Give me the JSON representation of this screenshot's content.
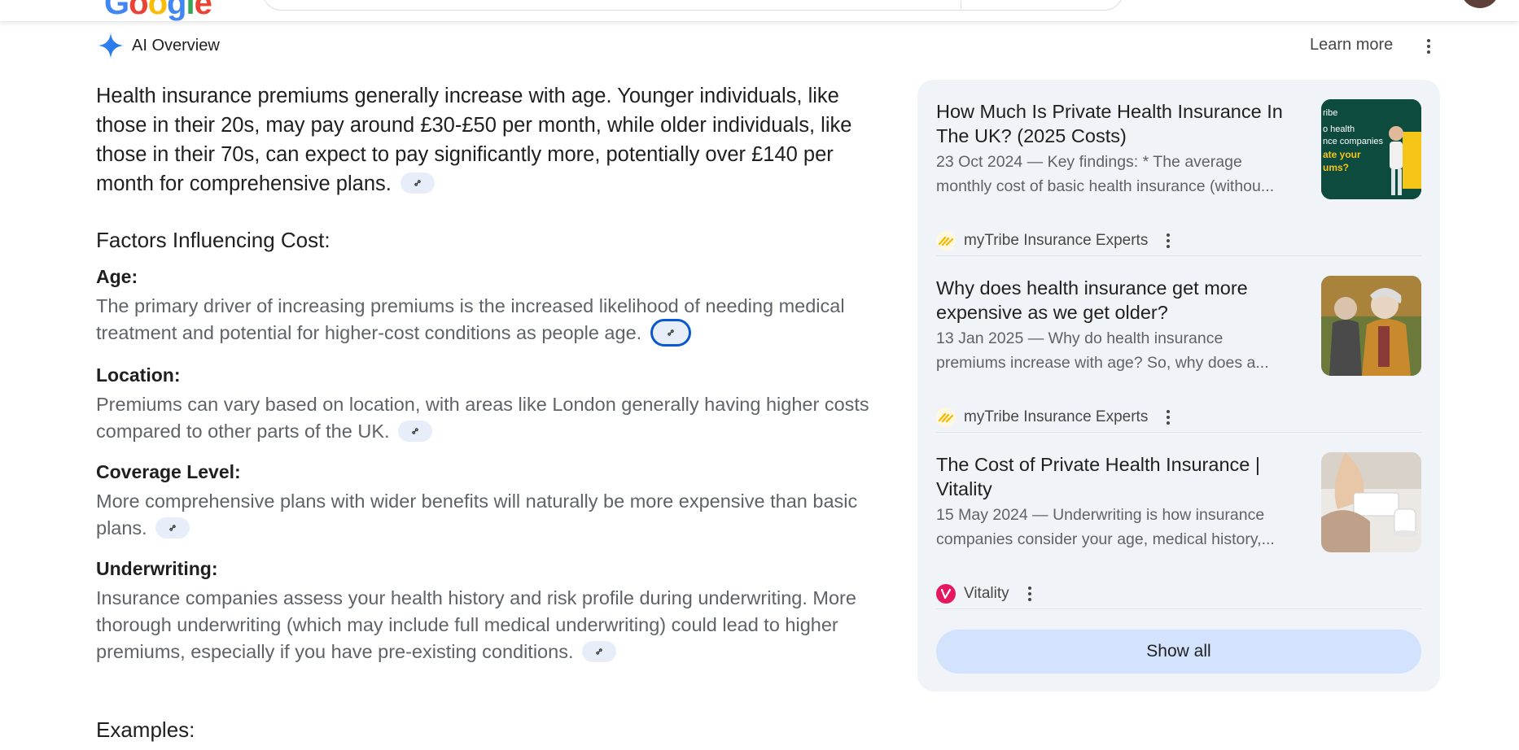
{
  "header": {
    "logo_text": [
      "G",
      "o",
      "o",
      "g",
      "l",
      "e"
    ]
  },
  "ai_overview": {
    "title": "AI Overview",
    "learn_more": "Learn more",
    "icon": "sparkle-icon"
  },
  "main": {
    "lead": "Health insurance premiums generally increase with age. Younger individuals, like those in their 20s, may pay around £30-£50 per month, while older individuals, like those in their 70s, can expect to pay significantly more, potentially over £140 per month for comprehensive plans.",
    "section_title": "Factors Influencing Cost:",
    "factors": [
      {
        "heading": "Age:",
        "text": "The primary driver of increasing premiums is the increased likelihood of needing medical treatment and potential for higher-cost conditions as people age."
      },
      {
        "heading": "Location:",
        "text": "Premiums can vary based on location, with areas like London generally having higher costs compared to other parts of the UK."
      },
      {
        "heading": "Coverage Level:",
        "text": "More comprehensive plans with wider benefits will naturally be more expensive than basic plans."
      },
      {
        "heading": "Underwriting:",
        "text": "Insurance companies assess your health history and risk profile during underwriting. More thorough underwriting (which may include full medical underwriting) could lead to higher premiums, especially if you have pre-existing conditions."
      }
    ],
    "examples_title": "Examples:"
  },
  "sources": {
    "items": [
      {
        "title": "How Much Is Private Health Insurance In The UK? (2025 Costs)",
        "snippet_1": "23 Oct 2024 — Key findings: * The average",
        "snippet_2": "monthly cost of basic health insurance (withou...",
        "site": "myTribe Insurance Experts",
        "thumb_text": "ribe\no health\nnce companies\nate your\nums?"
      },
      {
        "title": "Why does health insurance get more expensive as we get older?",
        "snippet_1": "13 Jan 2025 — Why do health insurance",
        "snippet_2": "premiums increase with age? So, why does a...",
        "site": "myTribe Insurance Experts"
      },
      {
        "title": "The Cost of Private Health Insurance | Vitality",
        "snippet_1": "15 May 2024 — Underwriting is how insurance",
        "snippet_2": "companies consider your age, medical history,...",
        "site": "Vitality"
      }
    ],
    "show_all": "Show all"
  },
  "colors": {
    "accent": "#0b57d0",
    "panel_bg": "#f0f4f9",
    "chip_bg": "#e8eef9",
    "show_all_bg": "#d3e3fd"
  }
}
